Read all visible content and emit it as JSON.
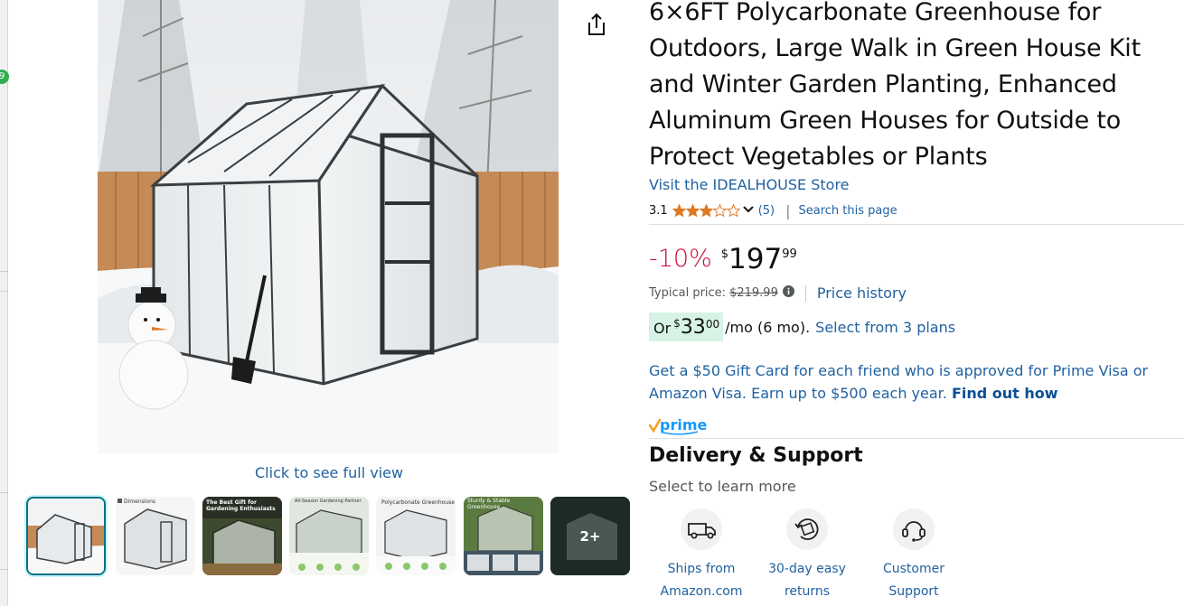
{
  "edge": {
    "badge": "9"
  },
  "gallery": {
    "see_full_view": "Click to see full view",
    "thumb_texts": [
      "Dimensions",
      "The Best Gift for Gardening Enthusiasts",
      "All-Season Gardening Partner",
      "Polycarbonate Greenhouse",
      "Sturdy & Stable Greenhouse"
    ],
    "more_label": "2+"
  },
  "product": {
    "title": "6×6FT Polycarbonate Greenhouse for Outdoors, Large Walk in Green House Kit and Winter Garden Planting, Enhanced Aluminum Green Houses for Outside to Protect Vegetables or Plants",
    "store_link": "Visit the IDEALHOUSE Store",
    "rating": "3.1",
    "rating_value": 3.1,
    "rating_count": "(5)",
    "search_page": "Search this page"
  },
  "price": {
    "discount": "-10%",
    "currency": "$",
    "whole": "197",
    "fraction": "99",
    "typical_label": "Typical price:",
    "typical_value": "$219.99",
    "price_history": "Price history",
    "monthly_or": "Or",
    "monthly_currency": "$",
    "monthly_whole": "33",
    "monthly_fraction": "00",
    "monthly_suffix": "/mo (6 mo).",
    "plans_link": "Select from 3 plans"
  },
  "promo": {
    "gift_text": "Get a $50 Gift Card for each friend who is approved for Prime Visa or Amazon Visa. Earn up to $500 each year.",
    "find_out": "Find out how"
  },
  "prime": {
    "label": "prime"
  },
  "delivery": {
    "title": "Delivery & Support",
    "subtitle": "Select to learn more",
    "items": [
      {
        "line1": "Ships from",
        "line2": "Amazon.com",
        "icon": "truck-icon"
      },
      {
        "line1": "30-day easy",
        "line2": "returns",
        "icon": "return-box-icon"
      },
      {
        "line1": "Customer",
        "line2": "Support",
        "icon": "headset-icon"
      }
    ]
  },
  "colors": {
    "link": "#2162A1",
    "discount": "#CC0C39",
    "badge_bg": "#D7F3E5",
    "star": "#DE7921",
    "prime": "#1399FF"
  }
}
